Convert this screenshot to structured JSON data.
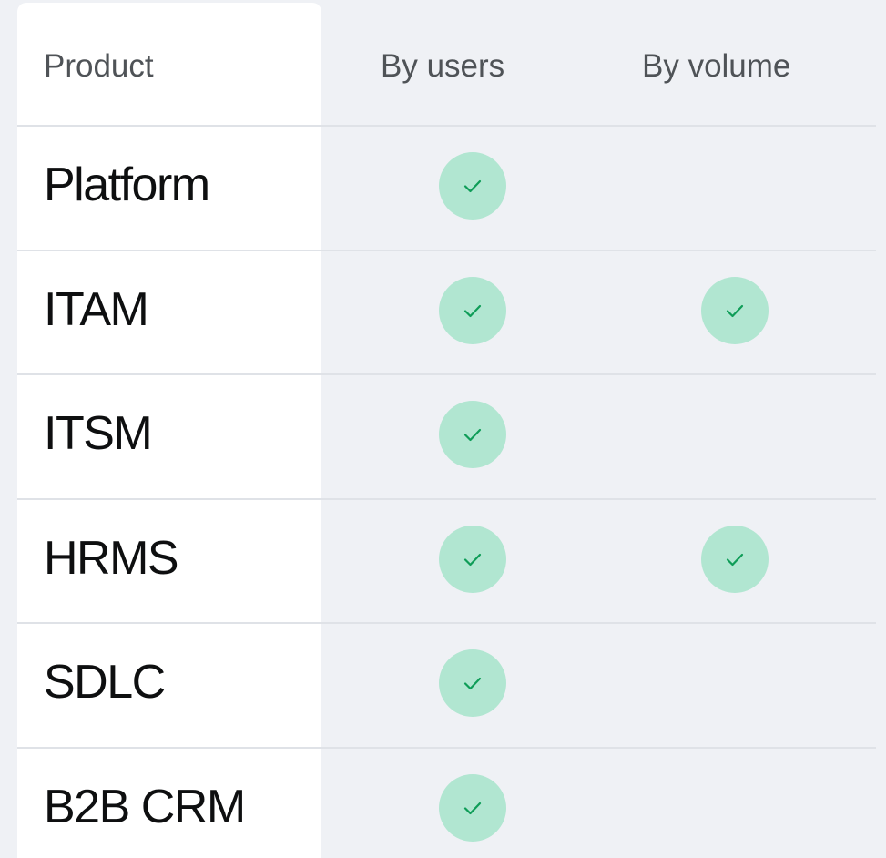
{
  "header": {
    "product": "Product",
    "by_users": "By users",
    "by_volume": "By volume"
  },
  "rows": [
    {
      "product": "Platform",
      "by_users": true,
      "by_volume": false
    },
    {
      "product": "ITAM",
      "by_users": true,
      "by_volume": true
    },
    {
      "product": "ITSM",
      "by_users": true,
      "by_volume": false
    },
    {
      "product": "HRMS",
      "by_users": true,
      "by_volume": true
    },
    {
      "product": "SDLC",
      "by_users": true,
      "by_volume": false
    },
    {
      "product": "B2B CRM",
      "by_users": true,
      "by_volume": false
    }
  ],
  "colors": {
    "page_background": "#eff1f5",
    "product_column_background": "#ffffff",
    "check_badge": "#b1e6d1",
    "check_mark": "#0f9d58",
    "divider": "#dfe2e7"
  },
  "icons": {
    "check": "check-icon"
  }
}
